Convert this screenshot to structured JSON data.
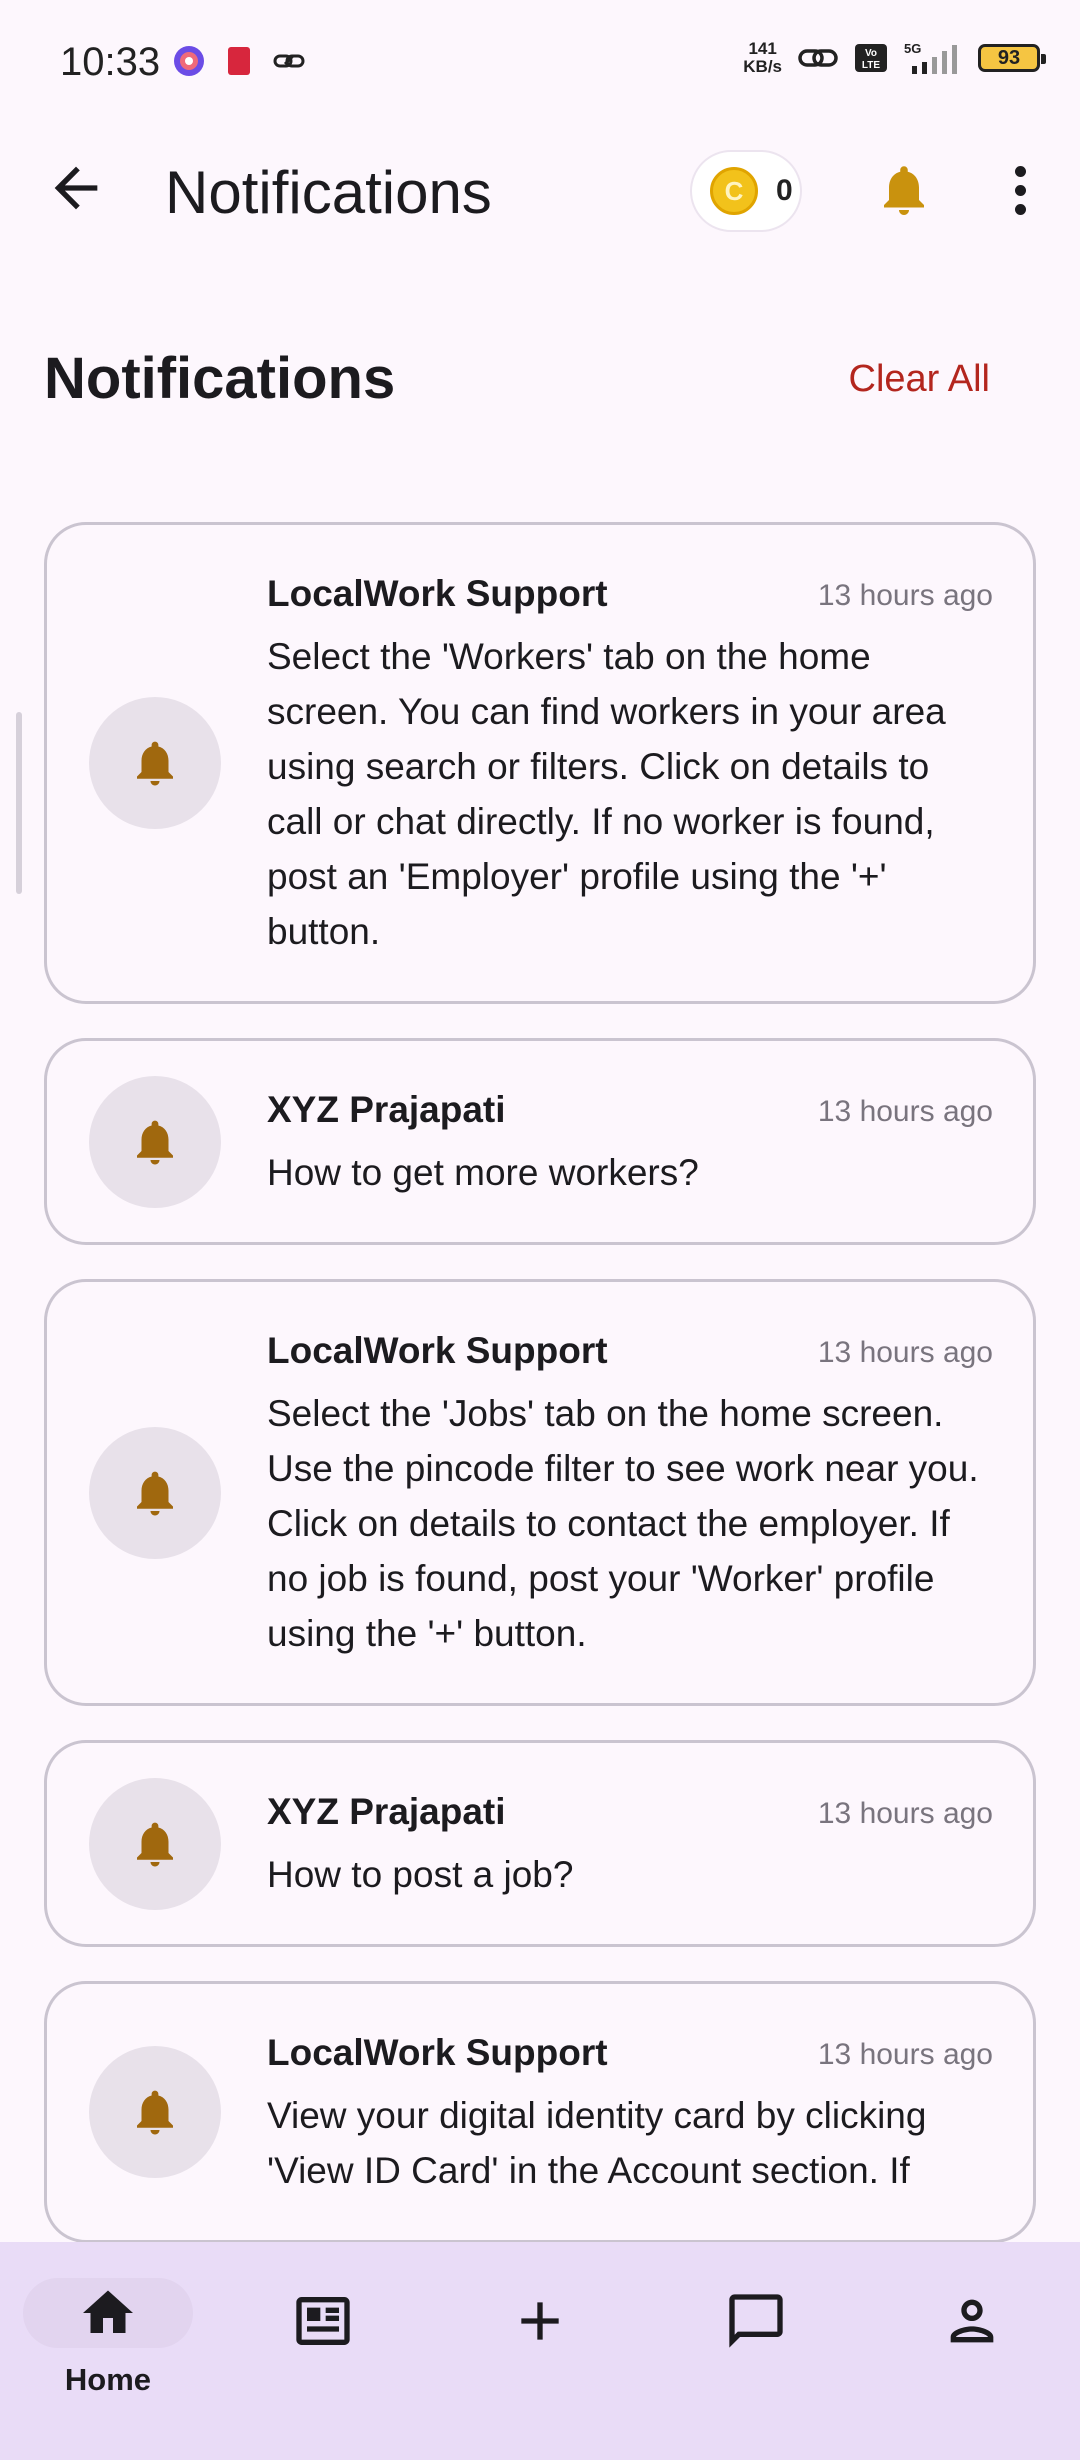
{
  "status_bar": {
    "time": "10:33",
    "net_speed_value": "141",
    "net_speed_unit": "KB/s",
    "volte": "Vo LTE",
    "network": "5G",
    "battery": "93"
  },
  "app_bar": {
    "title": "Notifications",
    "coin_count": "0",
    "coin_symbol": "C"
  },
  "header": {
    "title": "Notifications",
    "clear_all": "Clear All"
  },
  "notifications": [
    {
      "sender": "LocalWork Support",
      "time": "13 hours ago",
      "message": "Select the 'Workers' tab on the home screen. You can find workers in your area using search or filters. Click on details to call or chat directly. If no worker is found, post an 'Employer' profile using the '+' button."
    },
    {
      "sender": "XYZ Prajapati",
      "time": "13 hours ago",
      "message": "How to get more workers?"
    },
    {
      "sender": "LocalWork Support",
      "time": "13 hours ago",
      "message": "Select the 'Jobs' tab on the home screen. Use the pincode filter to see work near you. Click on details to contact the employer. If no job is found, post your 'Worker' profile using the '+' button."
    },
    {
      "sender": "XYZ Prajapati",
      "time": "13 hours ago",
      "message": "How to post a job?"
    },
    {
      "sender": "LocalWork Support",
      "time": "13 hours ago",
      "message": "View your digital identity card by clicking 'View ID Card' in the Account section. If"
    }
  ],
  "bottom_nav": {
    "home_label": "Home"
  },
  "colors": {
    "accent_red": "#b3261e",
    "bell_gold": "#a0680e",
    "nav_bg": "#e9dcf7"
  }
}
